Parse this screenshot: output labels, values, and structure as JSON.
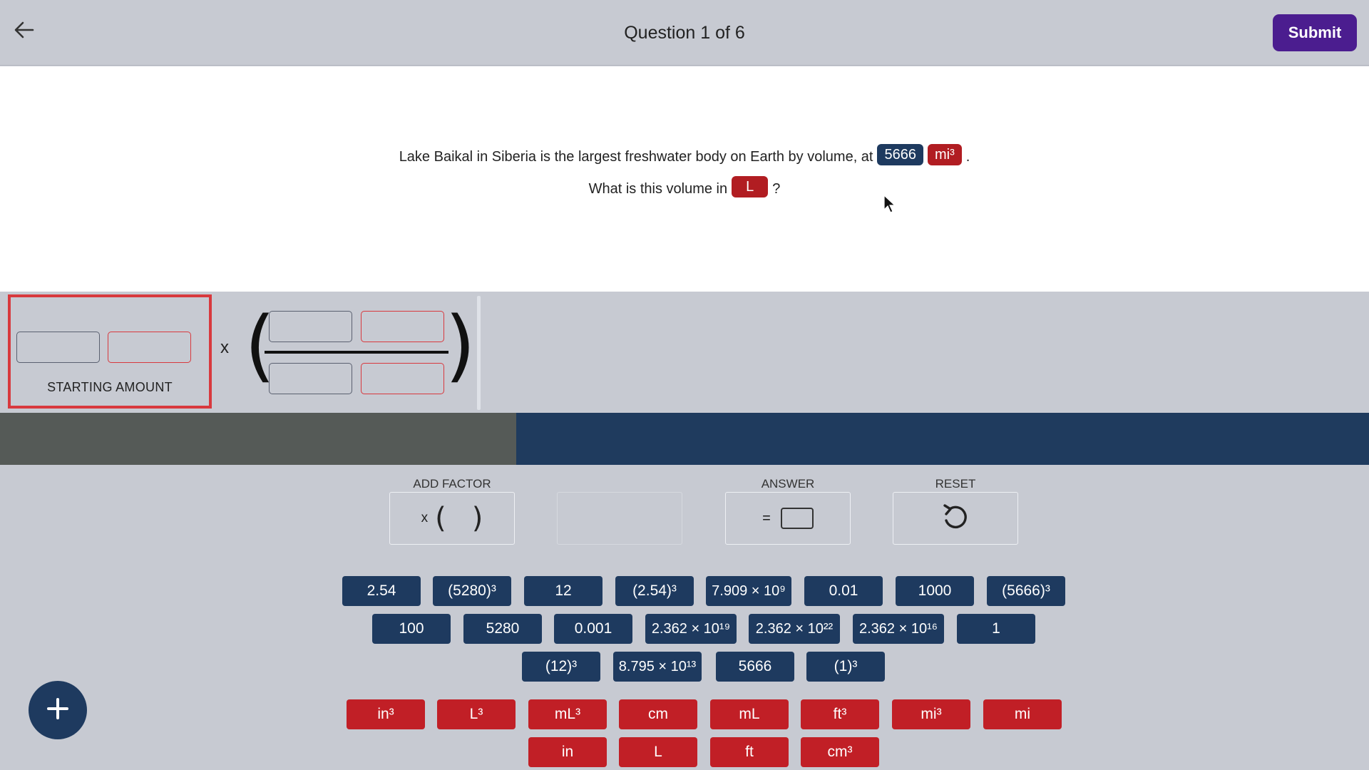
{
  "header": {
    "title": "Question 1 of 6",
    "submit_label": "Submit"
  },
  "question": {
    "line1_text": "Lake Baikal in Siberia is the largest freshwater body on Earth by volume, at",
    "given_value": "5666",
    "given_unit": "mi³",
    "line1_end": ".",
    "line2_text": "What is this volume in",
    "target_unit": "L",
    "line2_end": "?"
  },
  "equation": {
    "times_symbol": "x",
    "starting_amount_label": "STARTING AMOUNT",
    "open_paren": "(",
    "close_paren": ")"
  },
  "progress": {
    "fraction_complete": 0.377
  },
  "toolbar": {
    "add_factor_label": "ADD FACTOR",
    "add_factor_glyph_x": "x",
    "add_factor_open": "(",
    "add_factor_close": ")",
    "answer_label": "ANSWER",
    "answer_equals": "=",
    "reset_label": "RESET"
  },
  "number_tiles": {
    "row1": [
      "2.54",
      "(5280)³",
      "12",
      "(2.54)³",
      "7.909 × 10⁹",
      "0.01",
      "1000",
      "(5666)³"
    ],
    "row2": [
      "100",
      "5280",
      "0.001",
      "2.362 × 10¹⁹",
      "2.362 × 10²²",
      "2.362 × 10¹⁶",
      "1"
    ],
    "row3": [
      "(12)³",
      "8.795 × 10¹³",
      "5666",
      "(1)³"
    ]
  },
  "unit_tiles": {
    "row1": [
      "in³",
      "L³",
      "mL³",
      "cm",
      "mL",
      "ft³",
      "mi³",
      "mi"
    ],
    "row2": [
      "in",
      "L",
      "ft",
      "cm³"
    ]
  },
  "colors": {
    "number_tile": "#1e3a5f",
    "unit_tile": "#c11f26",
    "submit": "#4b1d8f",
    "background": "#c7cad2"
  },
  "icons": {
    "back": "arrow-left-icon",
    "reset": "undo-icon",
    "fab": "plus-icon",
    "cursor": "mouse-pointer-icon"
  }
}
